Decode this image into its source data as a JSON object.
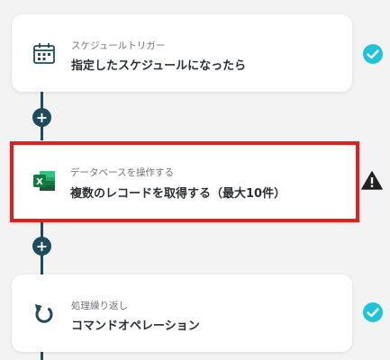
{
  "steps": [
    {
      "subtitle": "スケジュールトリガー",
      "title": "指定したスケジュールになったら",
      "icon": "calendar-icon",
      "status": "check-icon"
    },
    {
      "subtitle": "データベースを操作する",
      "title": "複数のレコードを取得する（最大10件）",
      "icon": "excel-icon",
      "status": "warning-icon"
    },
    {
      "subtitle": "処理繰り返し",
      "title": "コマンドオペレーション",
      "icon": "loop-icon",
      "status": "check-icon"
    }
  ],
  "add_buttons": [
    {
      "glyph": "+"
    },
    {
      "glyph": "+"
    }
  ],
  "colors": {
    "connector": "#1f4b5f",
    "check": "#20c4d8",
    "warning": "#222222",
    "selected_border": "#e0201f",
    "excel_green": "#1d7a46"
  }
}
